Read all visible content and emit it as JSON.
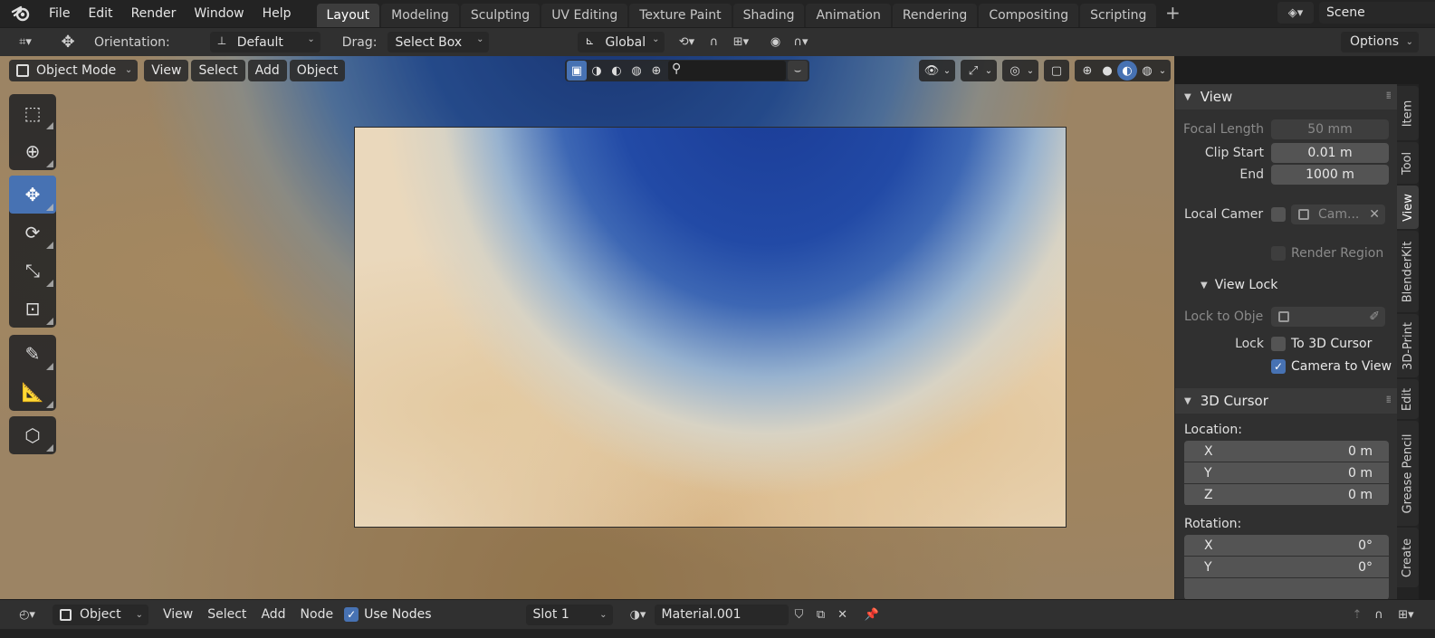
{
  "topbar": {
    "menus": [
      "File",
      "Edit",
      "Render",
      "Window",
      "Help"
    ],
    "workspace_tabs": [
      "Layout",
      "Modeling",
      "Sculpting",
      "UV Editing",
      "Texture Paint",
      "Shading",
      "Animation",
      "Rendering",
      "Compositing",
      "Scripting"
    ],
    "active_tab": "Layout",
    "scene_name": "Scene"
  },
  "tool_header": {
    "orientation_label": "Orientation:",
    "orientation_value": "Default",
    "drag_label": "Drag:",
    "drag_value": "Select Box",
    "transform_orientation": "Global",
    "options_label": "Options"
  },
  "viewport_header": {
    "mode": "Object Mode",
    "menus": [
      "View",
      "Select",
      "Add",
      "Object"
    ]
  },
  "toolbar": {
    "tools": [
      "select-box",
      "cursor",
      "move",
      "rotate",
      "scale",
      "transform",
      "annotate",
      "measure",
      "add-cube"
    ],
    "active_tool": "move"
  },
  "npanel": {
    "view_header": "View",
    "focal_length_label": "Focal Length",
    "focal_length_value": "50 mm",
    "clip_start_label": "Clip Start",
    "clip_start_value": "0.01 m",
    "clip_end_label": "End",
    "clip_end_value": "1000 m",
    "local_camera_label": "Local Camer",
    "local_camera_value": "Cam...",
    "render_region_label": "Render Region",
    "view_lock_header": "View Lock",
    "lock_to_object_label": "Lock to Obje",
    "lock_label": "Lock",
    "to_3d_cursor_label": "To 3D Cursor",
    "camera_to_view_label": "Camera to View",
    "cursor_header": "3D Cursor",
    "location_label": "Location:",
    "location": [
      {
        "axis": "X",
        "value": "0 m"
      },
      {
        "axis": "Y",
        "value": "0 m"
      },
      {
        "axis": "Z",
        "value": "0 m"
      }
    ],
    "rotation_label": "Rotation:",
    "rotation": [
      {
        "axis": "X",
        "value": "0°"
      },
      {
        "axis": "Y",
        "value": "0°"
      }
    ]
  },
  "sidebar_tabs": [
    "Item",
    "Tool",
    "View",
    "BlenderKit",
    "3D-Print",
    "Edit",
    "Grease Pencil",
    "Create"
  ],
  "active_sidebar_tab": "View",
  "bottom_bar": {
    "object_label": "Object",
    "menus": [
      "View",
      "Select",
      "Add",
      "Node"
    ],
    "use_nodes_label": "Use Nodes",
    "slot_value": "Slot 1",
    "material_value": "Material.001"
  }
}
